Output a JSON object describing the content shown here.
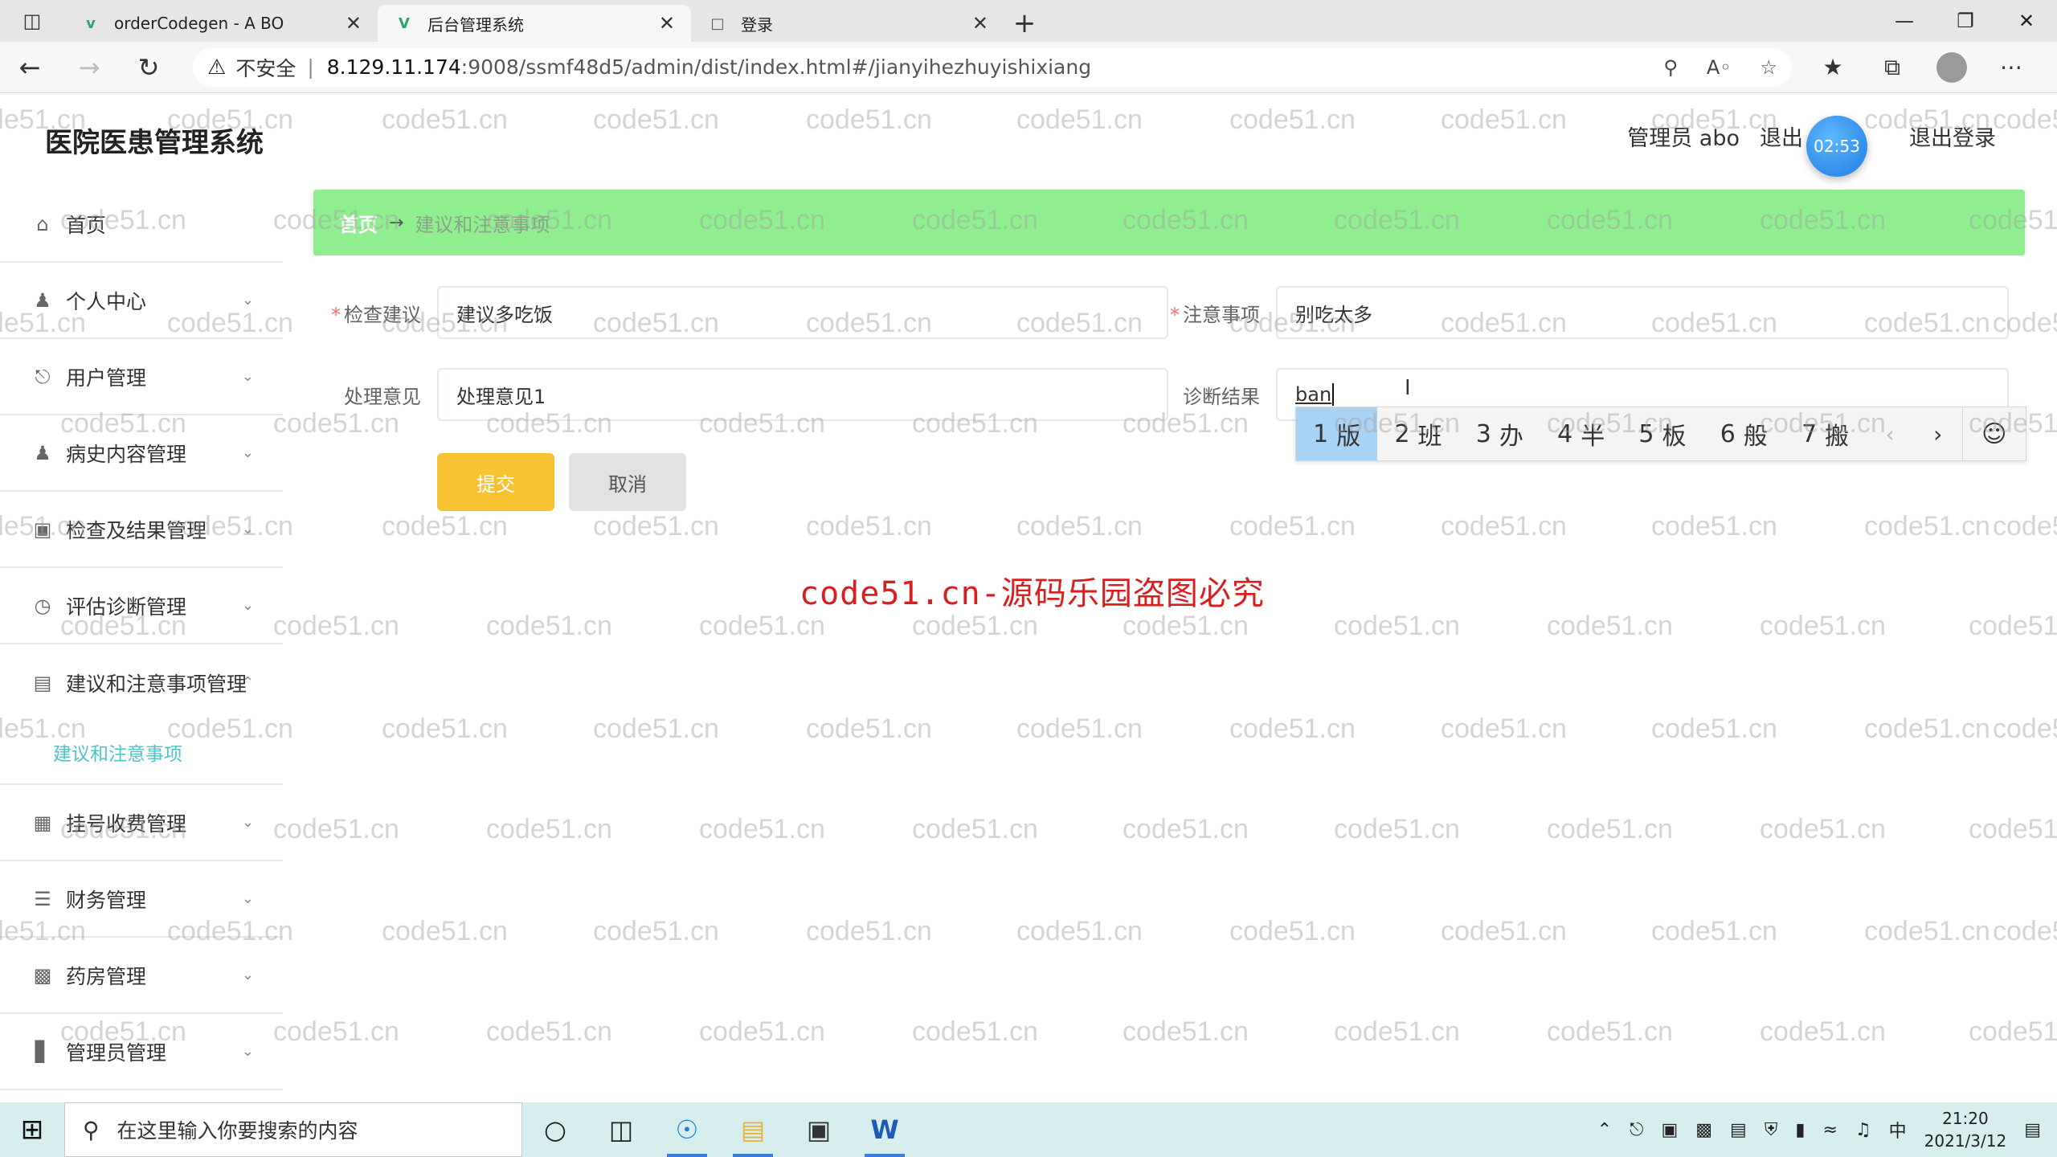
{
  "browser": {
    "tabs": [
      {
        "title": "orderCodegen - A BO",
        "favicon": "app-icon",
        "active": false
      },
      {
        "title": "后台管理系统",
        "favicon": "vue-icon",
        "active": true
      },
      {
        "title": "登录",
        "favicon": "page-icon",
        "active": false
      }
    ],
    "security_label": "不安全",
    "url_host": "8.129.11.174",
    "url_path": ":9008/ssmf48d5/admin/dist/index.html#/jianyihezhuyishixiang"
  },
  "app": {
    "title": "医院医患管理系统",
    "user_label": "管理员 abo",
    "quit_partial": "退出",
    "logout": "退出登录",
    "timer": "02:53"
  },
  "sidebar": {
    "items": [
      {
        "label": "首页",
        "icon": "home-icon",
        "expandable": false
      },
      {
        "label": "个人中心",
        "icon": "user-icon",
        "expandable": true
      },
      {
        "label": "用户管理",
        "icon": "microphone-icon",
        "expandable": true
      },
      {
        "label": "病史内容管理",
        "icon": "person-icon",
        "expandable": true
      },
      {
        "label": "检查及结果管理",
        "icon": "crop-icon",
        "expandable": true
      },
      {
        "label": "评估诊断管理",
        "icon": "clock-icon",
        "expandable": true
      },
      {
        "label": "建议和注意事项管理",
        "icon": "briefcase-icon",
        "expandable": true,
        "expanded": true
      },
      {
        "label": "挂号收费管理",
        "icon": "chart-icon",
        "expandable": true
      },
      {
        "label": "财务管理",
        "icon": "list-icon",
        "expandable": true
      },
      {
        "label": "药房管理",
        "icon": "bars-icon",
        "expandable": true
      },
      {
        "label": "管理员管理",
        "icon": "bar-chart-icon",
        "expandable": true
      }
    ],
    "sub_item": "建议和注意事项"
  },
  "breadcrumb": {
    "home": "首页",
    "arrow": "→",
    "current": "建议和注意事项"
  },
  "form": {
    "jiancha": {
      "label": "检查建议",
      "value": "建议多吃饭",
      "required": true
    },
    "zhuyi": {
      "label": "注意事项",
      "value": "别吃太多",
      "required": true
    },
    "chuli": {
      "label": "处理意见",
      "value": "处理意见1",
      "required": false
    },
    "zhenduan": {
      "label": "诊断结果",
      "value": "ban",
      "required": false
    },
    "submit": "提交",
    "cancel": "取消"
  },
  "ime": {
    "candidates": [
      {
        "num": "1",
        "char": "版"
      },
      {
        "num": "2",
        "char": "班"
      },
      {
        "num": "3",
        "char": "办"
      },
      {
        "num": "4",
        "char": "半"
      },
      {
        "num": "5",
        "char": "板"
      },
      {
        "num": "6",
        "char": "般"
      },
      {
        "num": "7",
        "char": "搬"
      }
    ]
  },
  "notice": "code51.cn-源码乐园盗图必究",
  "watermark_text": "code51.cn",
  "taskbar": {
    "search_placeholder": "在这里输入你要搜索的内容",
    "time": "21:20",
    "date": "2021/3/12",
    "ime_indicator": "中"
  },
  "colors": {
    "breadcrumb_bg": "#90ee90",
    "submit_bg": "#f7c333",
    "accent_teal": "#4fc3c7",
    "notice_red": "#d81e1e"
  }
}
